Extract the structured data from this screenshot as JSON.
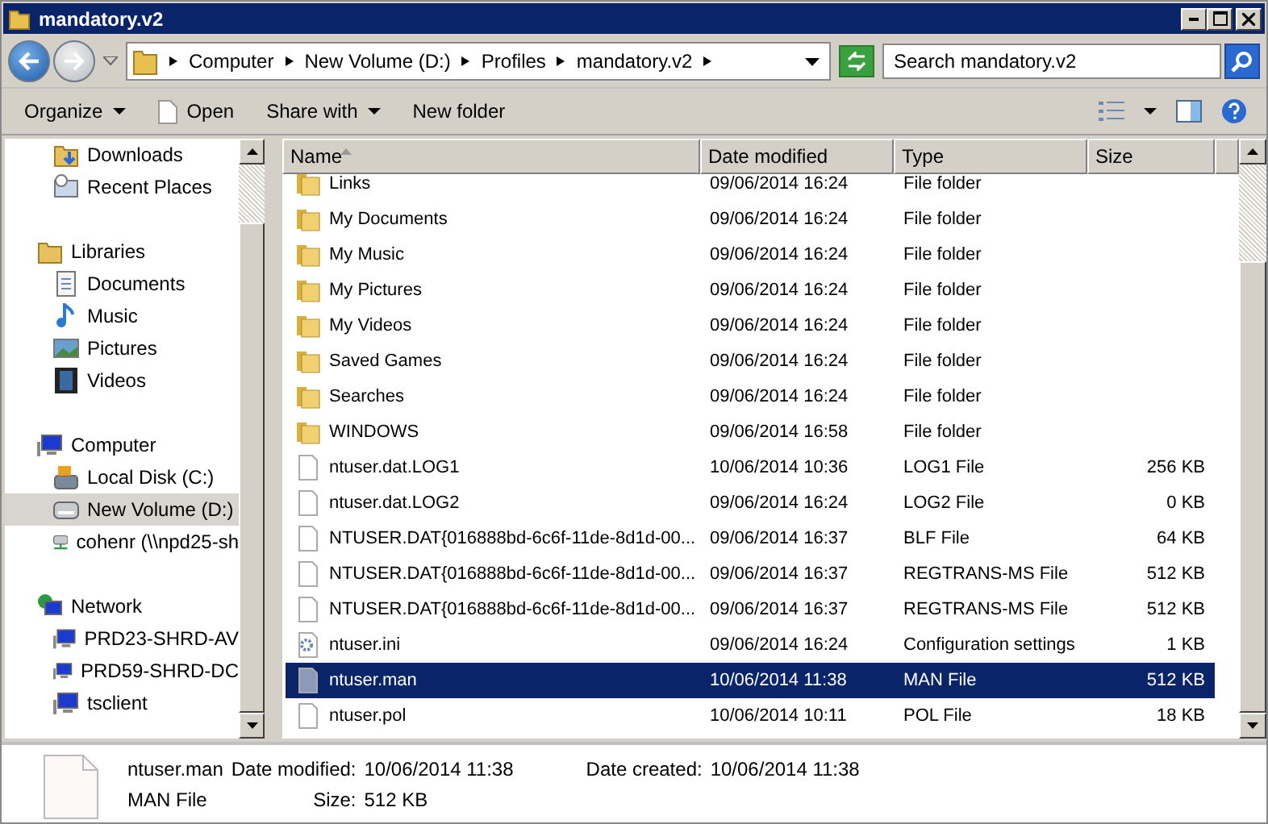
{
  "window": {
    "title": "mandatory.v2"
  },
  "address_bar": {
    "breadcrumbs": [
      "Computer",
      "New Volume (D:)",
      "Profiles",
      "mandatory.v2"
    ],
    "search": {
      "placeholder": "Search mandatory.v2"
    }
  },
  "toolbar": {
    "buttons": [
      {
        "label": "Organize",
        "kind": "menu"
      },
      {
        "label": "Open",
        "kind": "open"
      },
      {
        "label": "Share with",
        "kind": "menu"
      },
      {
        "label": "New folder",
        "kind": "command"
      }
    ]
  },
  "sidebar": {
    "scrolled_group_children": [
      {
        "label": "Downloads",
        "kind": "downloads",
        "selected": false
      },
      {
        "label": "Recent Places",
        "kind": "recent",
        "selected": false
      }
    ],
    "tree": [
      {
        "label": "Libraries",
        "kind": "library",
        "selected": false,
        "children": [
          {
            "label": "Documents",
            "kind": "documents",
            "selected": false
          },
          {
            "label": "Music",
            "kind": "music",
            "selected": false
          },
          {
            "label": "Pictures",
            "kind": "pictures",
            "selected": false
          },
          {
            "label": "Videos",
            "kind": "videos",
            "selected": false
          }
        ]
      },
      {
        "label": "Computer",
        "kind": "computer",
        "selected": false,
        "children": [
          {
            "label": "Local Disk (C:)",
            "kind": "disk",
            "selected": false
          },
          {
            "label": "New Volume (D:)",
            "kind": "drive",
            "selected": true
          },
          {
            "label": "cohenr (\\\\npd25-sh",
            "kind": "netdrive",
            "selected": false
          }
        ]
      },
      {
        "label": "Network",
        "kind": "network",
        "selected": false,
        "children": [
          {
            "label": "PRD23-SHRD-AV",
            "kind": "computer",
            "selected": false
          },
          {
            "label": "PRD59-SHRD-DC",
            "kind": "computer",
            "selected": false
          },
          {
            "label": "tsclient",
            "kind": "computer",
            "selected": false
          }
        ]
      }
    ]
  },
  "table": {
    "columns": [
      {
        "label": "Name",
        "sorted": true
      },
      {
        "label": "Date modified",
        "sorted": false
      },
      {
        "label": "Type",
        "sorted": false
      },
      {
        "label": "Size",
        "sorted": false
      }
    ],
    "rows": [
      {
        "name": "Links",
        "date": "09/06/2014 16:24",
        "type": "File folder",
        "size": "",
        "kind": "folder",
        "selected": false
      },
      {
        "name": "My Documents",
        "date": "09/06/2014 16:24",
        "type": "File folder",
        "size": "",
        "kind": "folder",
        "selected": false
      },
      {
        "name": "My Music",
        "date": "09/06/2014 16:24",
        "type": "File folder",
        "size": "",
        "kind": "folder",
        "selected": false
      },
      {
        "name": "My Pictures",
        "date": "09/06/2014 16:24",
        "type": "File folder",
        "size": "",
        "kind": "folder",
        "selected": false
      },
      {
        "name": "My Videos",
        "date": "09/06/2014 16:24",
        "type": "File folder",
        "size": "",
        "kind": "folder",
        "selected": false
      },
      {
        "name": "Saved Games",
        "date": "09/06/2014 16:24",
        "type": "File folder",
        "size": "",
        "kind": "folder",
        "selected": false
      },
      {
        "name": "Searches",
        "date": "09/06/2014 16:24",
        "type": "File folder",
        "size": "",
        "kind": "folder",
        "selected": false
      },
      {
        "name": "WINDOWS",
        "date": "09/06/2014 16:58",
        "type": "File folder",
        "size": "",
        "kind": "folder",
        "selected": false
      },
      {
        "name": "ntuser.dat.LOG1",
        "date": "10/06/2014 10:36",
        "type": "LOG1 File",
        "size": "256 KB",
        "kind": "file",
        "selected": false
      },
      {
        "name": "ntuser.dat.LOG2",
        "date": "09/06/2014 16:24",
        "type": "LOG2 File",
        "size": "0 KB",
        "kind": "file",
        "selected": false
      },
      {
        "name": "NTUSER.DAT{016888bd-6c6f-11de-8d1d-00...",
        "date": "09/06/2014 16:37",
        "type": "BLF File",
        "size": "64 KB",
        "kind": "file",
        "selected": false
      },
      {
        "name": "NTUSER.DAT{016888bd-6c6f-11de-8d1d-00...",
        "date": "09/06/2014 16:37",
        "type": "REGTRANS-MS File",
        "size": "512 KB",
        "kind": "file",
        "selected": false
      },
      {
        "name": "NTUSER.DAT{016888bd-6c6f-11de-8d1d-00...",
        "date": "09/06/2014 16:37",
        "type": "REGTRANS-MS File",
        "size": "512 KB",
        "kind": "file",
        "selected": false
      },
      {
        "name": "ntuser.ini",
        "date": "09/06/2014 16:24",
        "type": "Configuration settings",
        "size": "1 KB",
        "kind": "config",
        "selected": false
      },
      {
        "name": "ntuser.man",
        "date": "10/06/2014 11:38",
        "type": "MAN File",
        "size": "512 KB",
        "kind": "file",
        "selected": true
      },
      {
        "name": "ntuser.pol",
        "date": "10/06/2014 10:11",
        "type": "POL File",
        "size": "18 KB",
        "kind": "file",
        "selected": false
      }
    ]
  },
  "details_pane": {
    "name": "ntuser.man",
    "type": "MAN File",
    "fields": [
      {
        "label": "Date modified:",
        "value": "10/06/2014 11:38"
      },
      {
        "label": "Date created:",
        "value": "10/06/2014 11:38"
      },
      {
        "label": "Size:",
        "value": "512 KB"
      }
    ]
  }
}
